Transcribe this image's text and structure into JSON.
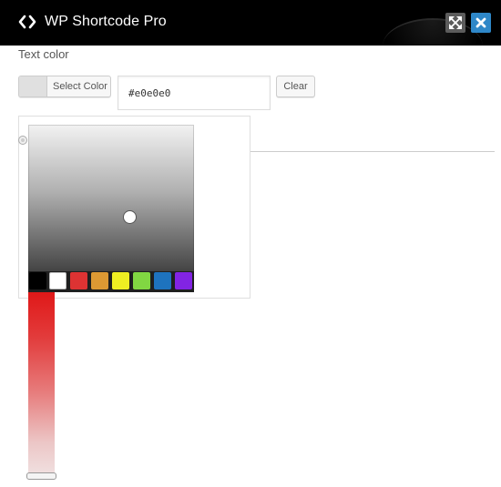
{
  "window": {
    "title": "WP Shortcode Pro",
    "icons": {
      "app": "code-brackets-icon",
      "expand": "expand-arrows-icon",
      "close": "close-x-icon"
    },
    "colors": {
      "titlebar_bg": "#000000",
      "expand_bg": "#5c5c5c",
      "close_bg": "#2e87c8"
    }
  },
  "field": {
    "label": "Text color",
    "select_label": "Select Color",
    "hex_value": "#e0e0e0",
    "clear_label": "Clear",
    "current_color": "#e0e0e0"
  },
  "picker": {
    "hue_color": "#e01818",
    "palette": [
      {
        "name": "black",
        "color": "#000000"
      },
      {
        "name": "white",
        "color": "#ffffff"
      },
      {
        "name": "red",
        "color": "#dd3333"
      },
      {
        "name": "orange",
        "color": "#dd9933"
      },
      {
        "name": "yellow",
        "color": "#eeee22"
      },
      {
        "name": "green",
        "color": "#81d742"
      },
      {
        "name": "blue",
        "color": "#1e73be"
      },
      {
        "name": "purple",
        "color": "#8224e3"
      }
    ]
  }
}
